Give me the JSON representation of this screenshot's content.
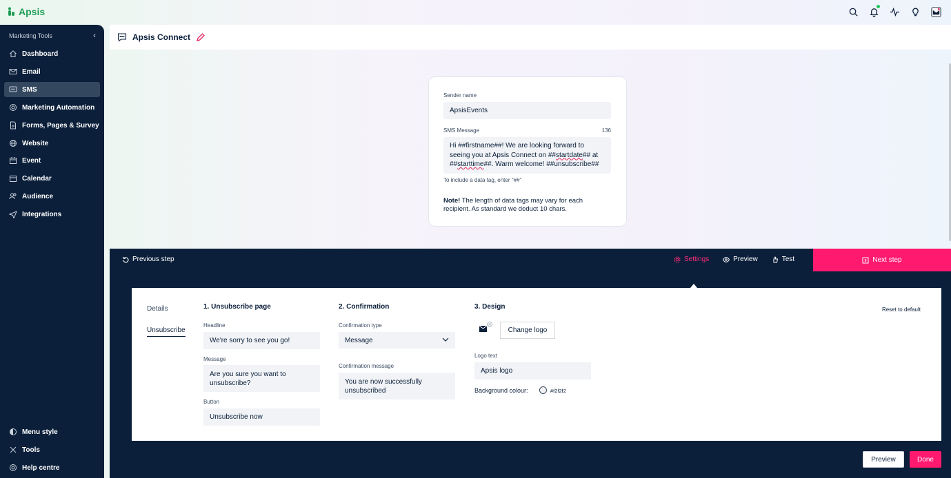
{
  "app": {
    "brand": "Apsis"
  },
  "topbar": {
    "icons": [
      "search-icon",
      "bell-icon",
      "activity-icon",
      "lightbulb-icon",
      "account-icon"
    ]
  },
  "sidebar": {
    "heading": "Marketing Tools",
    "collapse_glyph": "‹",
    "items": [
      {
        "label": "Dashboard",
        "icon": "home-icon"
      },
      {
        "label": "Email",
        "icon": "mail-icon"
      },
      {
        "label": "SMS",
        "icon": "chat-icon",
        "active": true
      },
      {
        "label": "Marketing Automation",
        "icon": "automation-icon"
      },
      {
        "label": "Forms, Pages & Survey",
        "icon": "forms-icon"
      },
      {
        "label": "Website",
        "icon": "globe-icon"
      },
      {
        "label": "Event",
        "icon": "event-icon"
      },
      {
        "label": "Calendar",
        "icon": "calendar-icon"
      },
      {
        "label": "Audience",
        "icon": "audience-icon"
      },
      {
        "label": "Integrations",
        "icon": "integrations-icon"
      }
    ],
    "bottom": [
      {
        "label": "Menu style",
        "icon": "contrast-icon"
      },
      {
        "label": "Tools",
        "icon": "tools-icon"
      },
      {
        "label": "Help centre",
        "icon": "help-icon"
      }
    ]
  },
  "header": {
    "title": "Apsis Connect"
  },
  "sms_card": {
    "sender_label": "Sender name",
    "sender_value": "ApsisEvents",
    "message_label": "SMS Message",
    "char_count": "136",
    "message_parts": {
      "p1": "Hi ##firstname##! We are looking forward to seeing you at Apsis Connect on ##",
      "p2": "startdate",
      "p3": "## at ##",
      "p4": "starttime",
      "p5": "##. Warm welcome! ##unsubscribe##"
    },
    "hint": "To include a data tag, enter \"##\"",
    "note_bold": "Note!",
    "note_text": " The length of data tags may vary for each recipient. As standard we deduct 10 chars."
  },
  "stepbar": {
    "previous": "Previous step",
    "tabs": [
      {
        "label": "Settings",
        "icon": "gear-icon",
        "active": true
      },
      {
        "label": "Preview",
        "icon": "eye-icon"
      },
      {
        "label": "Test",
        "icon": "test-icon"
      }
    ],
    "next": "Next step"
  },
  "settings_panel": {
    "nav": [
      "Details",
      "Unsubscribe"
    ],
    "unsubscribe_page": {
      "title": "1. Unsubscribe page",
      "headline_label": "Headline",
      "headline_value": "We're sorry to see you go!",
      "message_label": "Message",
      "message_value": "Are you sure you want to unsubscribe?",
      "button_label": "Button",
      "button_value": "Unsubscribe now"
    },
    "confirmation": {
      "title": "2. Confirmation",
      "type_label": "Confirmation type",
      "type_value": "Message",
      "message_label": "Confirmation message",
      "message_value": "You are now successfully unsubscribed"
    },
    "design": {
      "title": "3. Design",
      "reset": "Reset to default",
      "change_logo": "Change logo",
      "logo_text_label": "Logo text",
      "logo_text_value": "Apsis logo",
      "bg_label": "Background colour:",
      "bg_value": "#f2f2f2"
    }
  },
  "footer": {
    "preview": "Preview",
    "done": "Done"
  },
  "colors": {
    "navy": "#0b1f3a",
    "accent": "#ff1a70",
    "brand_green": "#1f9d55"
  }
}
